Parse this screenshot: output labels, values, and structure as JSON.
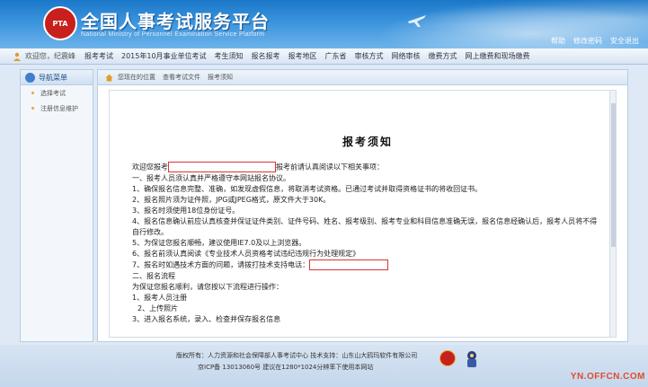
{
  "header": {
    "logo_text": "PTA",
    "title": "全国人事考试服务平台",
    "subtitle": "National Ministry of Personnel Examination Service Platform",
    "links": [
      "帮助",
      "修改密码",
      "安全退出"
    ]
  },
  "nav": {
    "welcome": "欢迎您，",
    "user": "纪震峰",
    "items": [
      "报考考试",
      "2015年10月事业单位考试",
      "考生须知",
      "报名报考",
      "报考地区",
      "广东省",
      "审核方式",
      "网络审核",
      "缴费方式",
      "网上缴费和现场缴费"
    ]
  },
  "sidebar": {
    "header": "导航菜单",
    "items": [
      "选择考试",
      "注册信息维护"
    ]
  },
  "breadcrumb": [
    "您现在的位置",
    "查看考试文件",
    "报考须知"
  ],
  "notice": {
    "title": "报考须知",
    "lines": [
      "欢迎您报考",
      "报考前请认真阅读以下相关事项：",
      "一、报考人员须认真并严格遵守本网站报名协议。",
      "1、确保报名信息完整、准确，如发现虚假信息，将取消考试资格。已通过考试并取得资格证书的将收回证书。",
      "2、报名照片须为证件照，JPG或JPEG格式，原文件大于30K。",
      "3、报名时须使用18位身份证号。",
      "4、报名信息确认前应认真核查并保证证件类别、证件号码、姓名、报考级别、报考专业和科目信息准确无误，报名信息经确认后，报考人员将不得自行修改。",
      "5、为保证您报名顺畅，建议使用IE7.0及以上浏览器。",
      "6、报名前须认真阅读《专业技术人员资格考试违纪违规行为处理规定》",
      "7、报名时如遇技术方面的问题，请拨打技术支持电话：",
      "二、报名流程",
      "为保证您报名顺利，请您按以下流程进行操作：",
      "1、报考人员注册",
      "2、上传照片",
      "3、进入报名系统，录入、检查并保存报名信息"
    ]
  },
  "footer": {
    "line1": "版权所有：人力资源和社会保障部人事考试中心    技术支持：山东山大鸥玛软件有限公司",
    "line2": "京ICP备 13013060号    建议在1280*1024分辨率下使用本网站"
  },
  "watermark": "YN.OFFCN.COM",
  "colors": {
    "header_blue": "#1b78c9",
    "emblem_red": "#c8201c",
    "watermark": "#e14b2f"
  }
}
